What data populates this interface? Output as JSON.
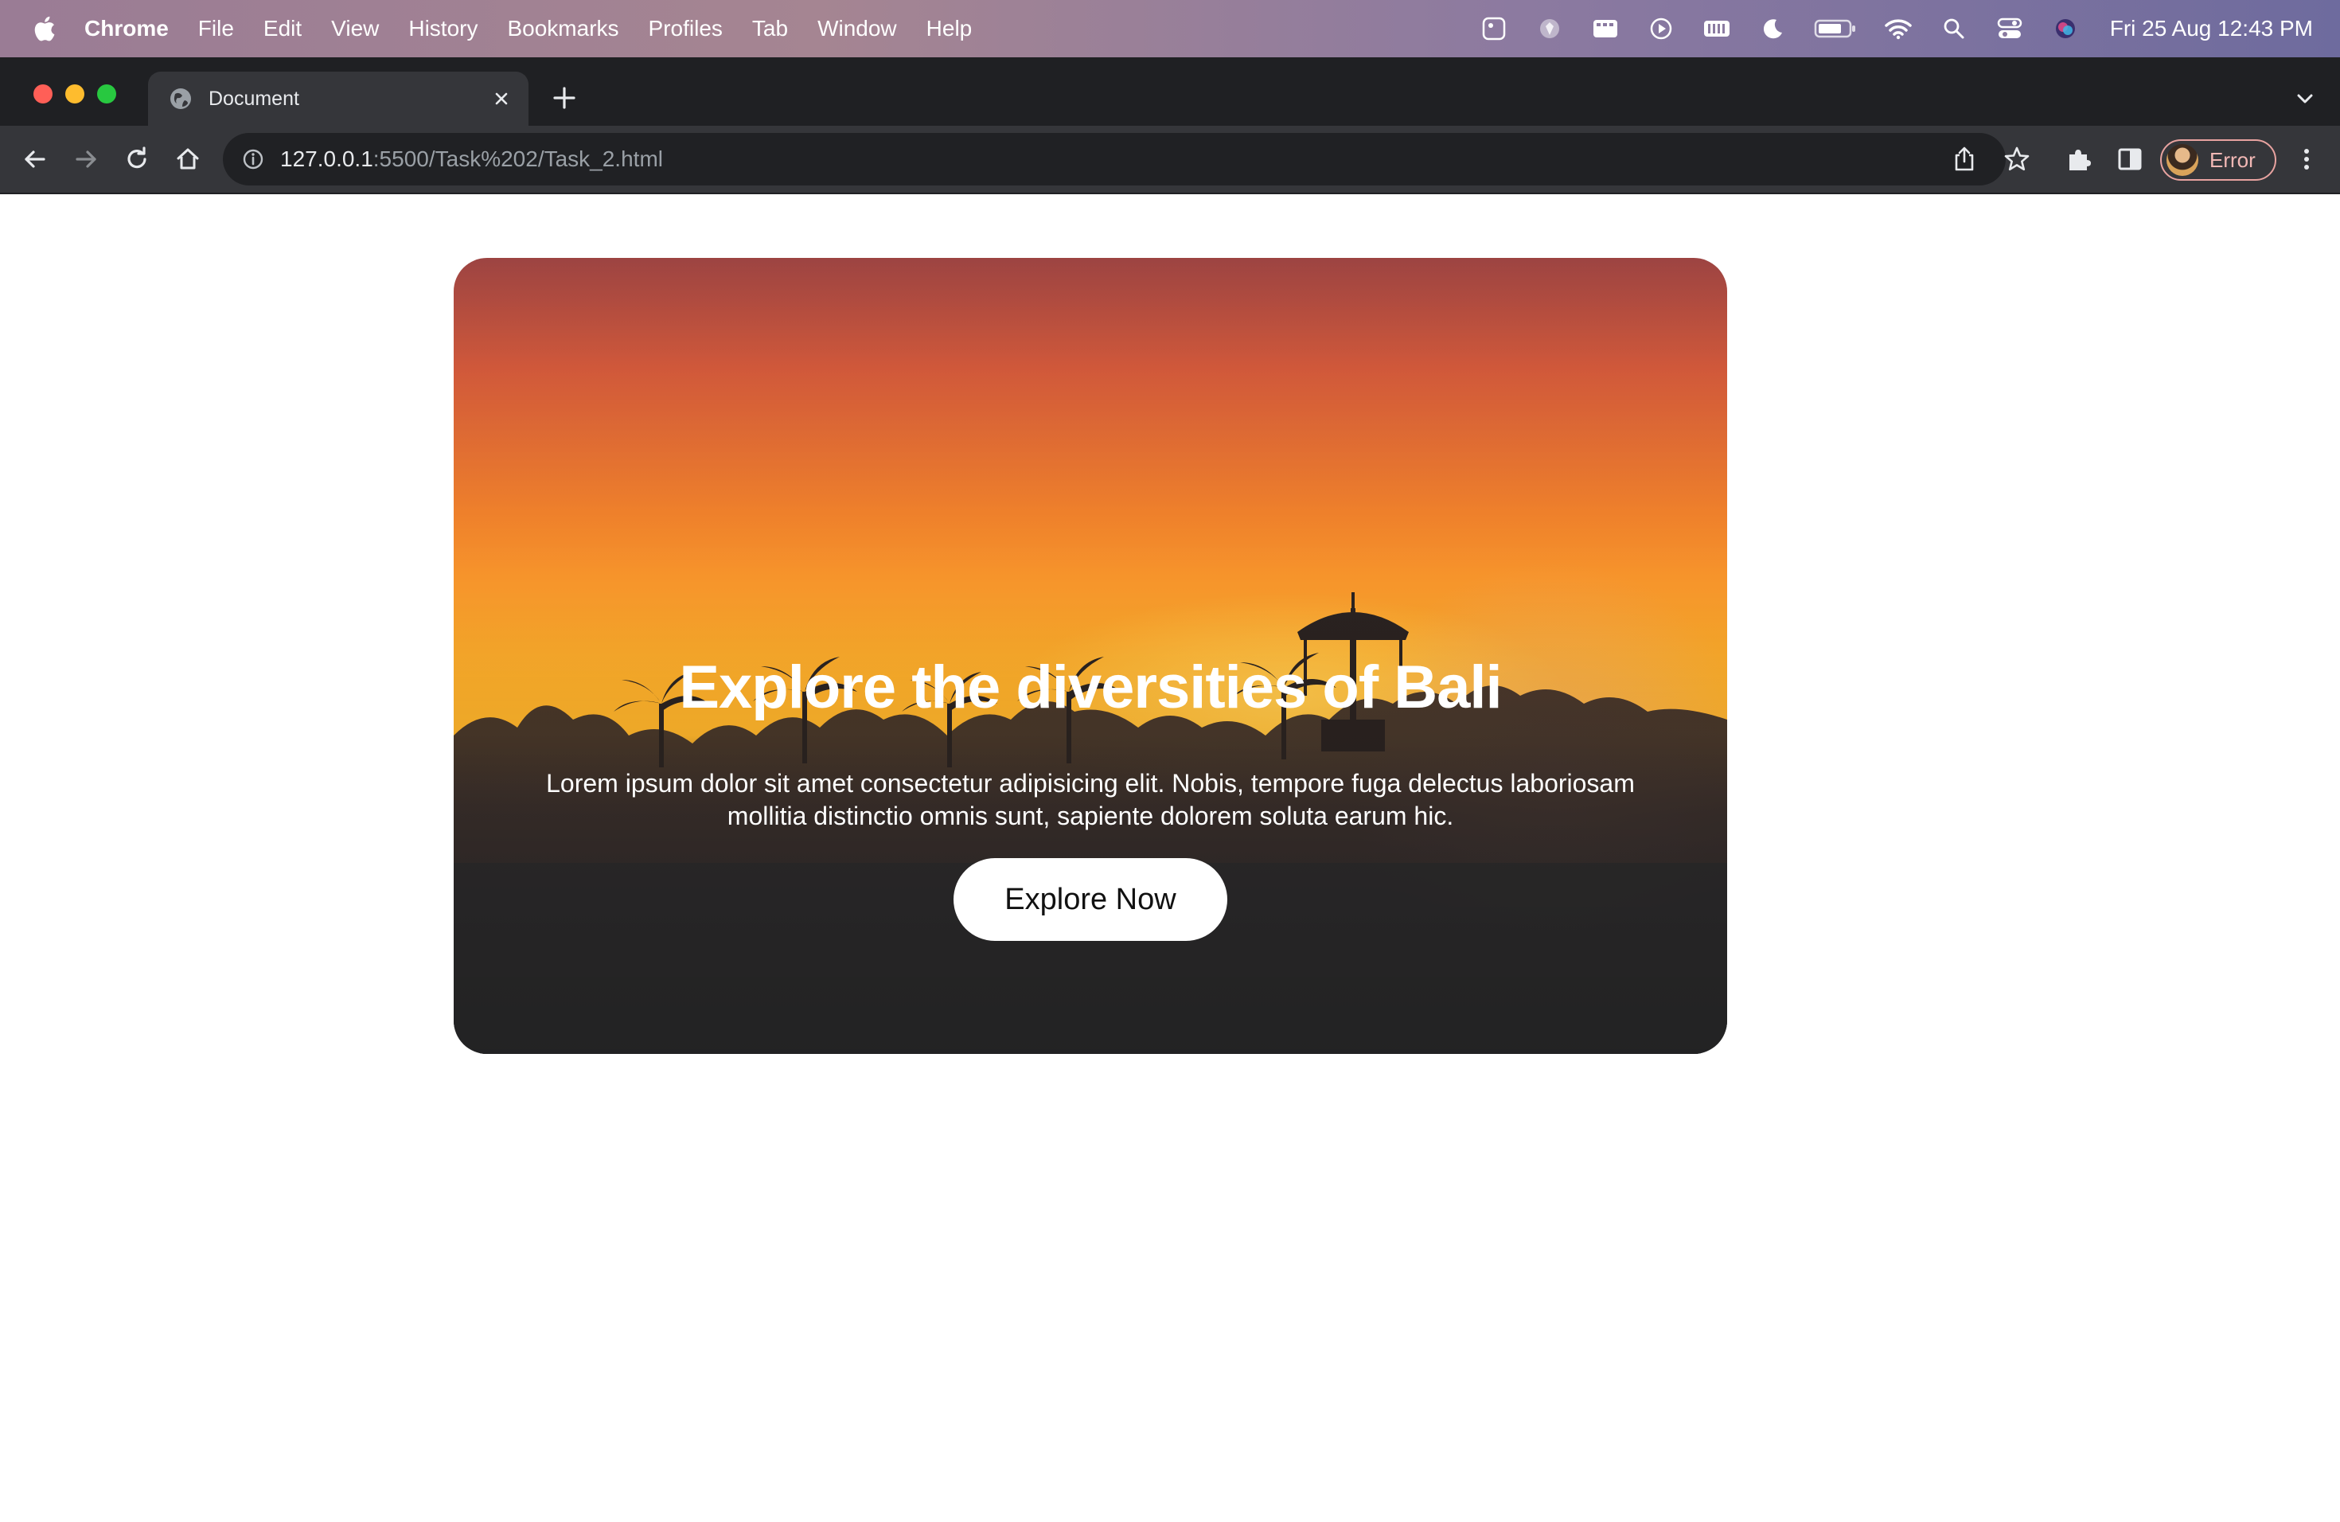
{
  "menubar": {
    "app_name": "Chrome",
    "items": [
      "File",
      "Edit",
      "View",
      "History",
      "Bookmarks",
      "Profiles",
      "Tab",
      "Window",
      "Help"
    ],
    "clock": "Fri 25 Aug  12:43 PM"
  },
  "browser": {
    "tab_title": "Document",
    "url_host": "127.0.0.1",
    "url_rest": ":5500/Task%202/Task_2.html",
    "profile_status": "Error"
  },
  "hero": {
    "title": "Explore the diversities of Bali",
    "text_line1": "Lorem ipsum dolor sit amet consectetur adipisicing elit. Nobis, tempore fuga delectus laboriosam",
    "text_line2": "mollitia distinctio omnis sunt, sapiente dolorem soluta earum hic.",
    "button_label": "Explore Now"
  },
  "colors": {
    "tab_strip": "#1f2023",
    "toolbar": "#35363a",
    "omnibox": "#202124",
    "traffic_close": "#ff5f57",
    "traffic_minimize": "#febc2e",
    "traffic_zoom": "#28c840"
  }
}
